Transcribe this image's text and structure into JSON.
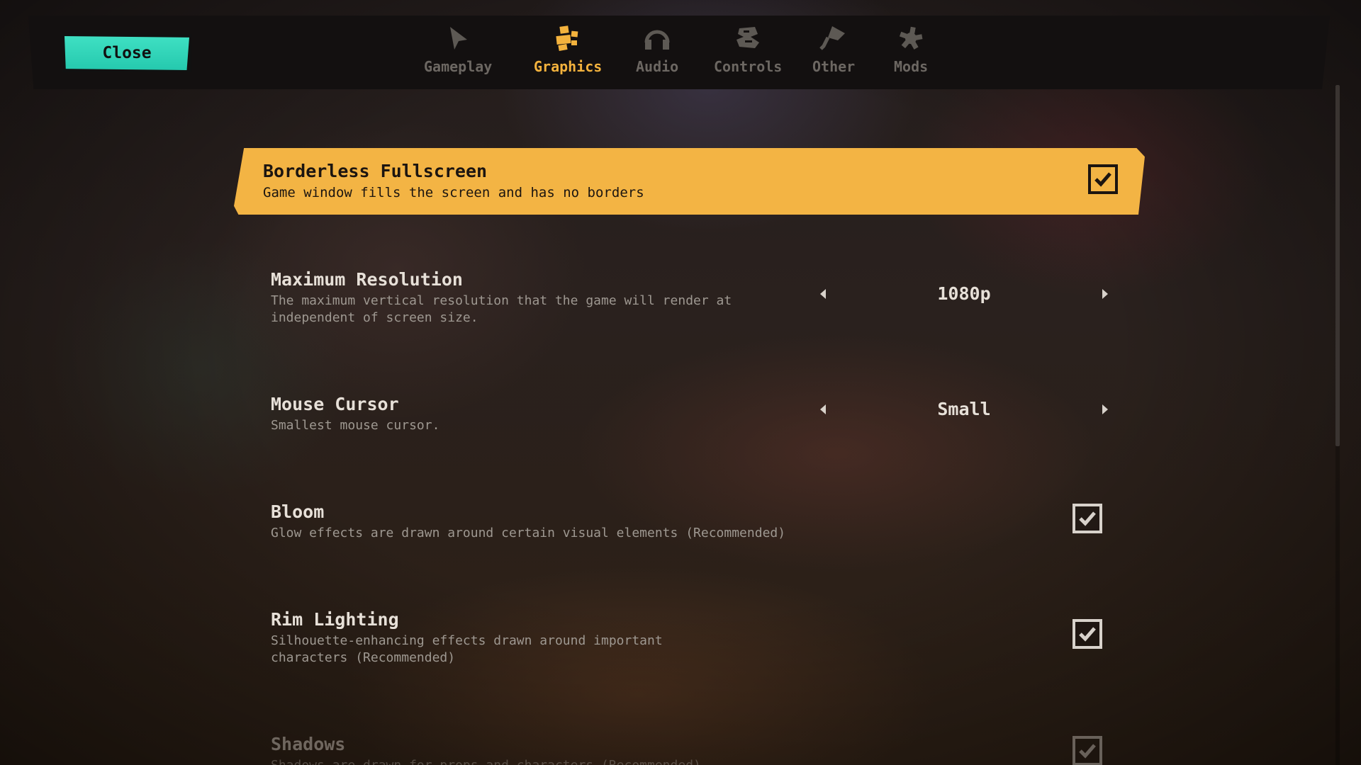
{
  "close_button": {
    "label": "Close"
  },
  "tabs": [
    {
      "label": "Gameplay",
      "icon": "cursor-icon",
      "active": false
    },
    {
      "label": "Graphics",
      "icon": "graphics-blocks-icon",
      "active": true
    },
    {
      "label": "Audio",
      "icon": "headphones-icon",
      "active": false
    },
    {
      "label": "Controls",
      "icon": "controller-icon",
      "active": false
    },
    {
      "label": "Other",
      "icon": "megaphone-icon",
      "active": false
    },
    {
      "label": "Mods",
      "icon": "gear-icon",
      "active": false
    }
  ],
  "settings": {
    "borderless": {
      "title": "Borderless Fullscreen",
      "description": "Game window fills the screen and has no borders",
      "checked": true
    },
    "max_resolution": {
      "title": "Maximum Resolution",
      "description": "The maximum vertical resolution that the game will render at independent of screen size.",
      "value": "1080p"
    },
    "mouse_cursor": {
      "title": "Mouse Cursor",
      "description": "Smallest mouse cursor.",
      "value": "Small"
    },
    "bloom": {
      "title": "Bloom",
      "description": "Glow effects are drawn around certain visual elements (Recommended)",
      "checked": true
    },
    "rim_lighting": {
      "title": "Rim Lighting",
      "description": "Silhouette-enhancing effects drawn around important characters (Recommended)",
      "checked": true
    },
    "shadows": {
      "title": "Shadows",
      "description": "Shadows are drawn for props and characters (Recommended)",
      "checked": true
    }
  },
  "colors": {
    "accent_orange": "#f3b444",
    "close_teal": "#2fd6b9",
    "active_tab": "#f3b23d",
    "inactive_tab": "#6c6762"
  }
}
